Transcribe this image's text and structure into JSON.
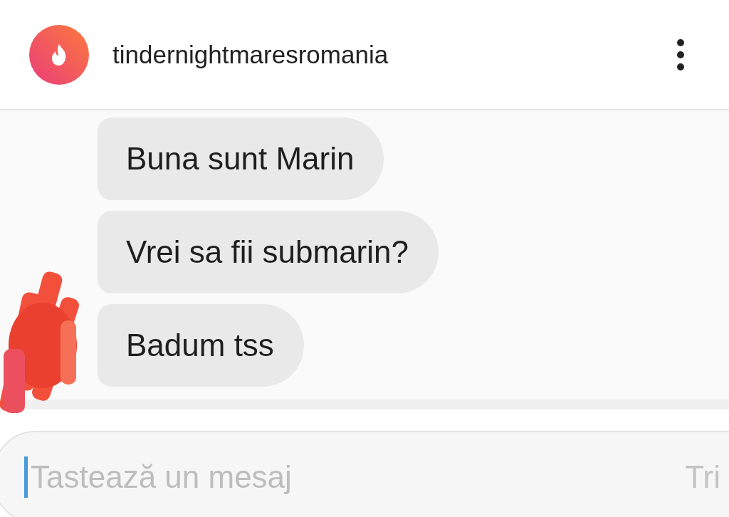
{
  "header": {
    "title": "tindernightmaresromania"
  },
  "messages": [
    {
      "text": "Buna sunt Marin"
    },
    {
      "text": "Vrei sa fii submarin?"
    },
    {
      "text": "Badum tss"
    }
  ],
  "composer": {
    "placeholder": "Tastează un mesaj",
    "send_label": "Tri"
  }
}
